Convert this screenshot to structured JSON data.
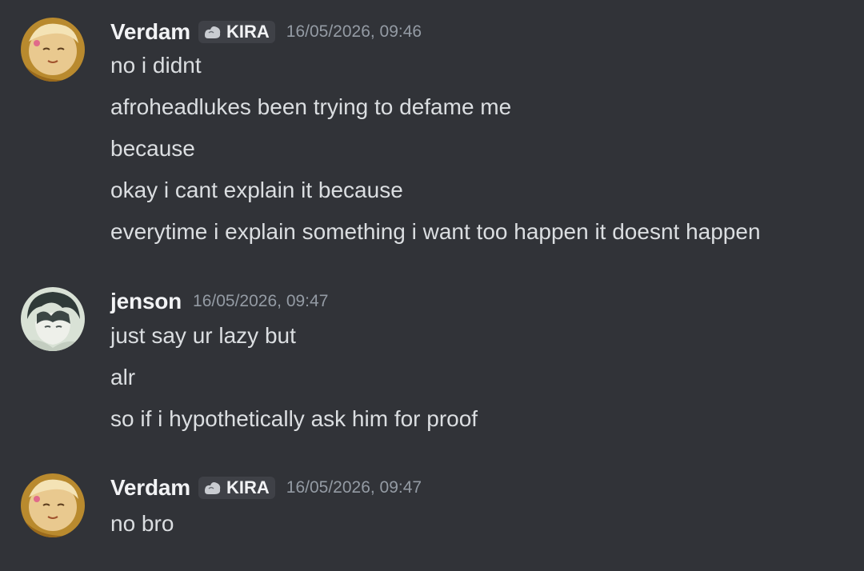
{
  "messages": [
    {
      "author": "Verdam",
      "tag": "KIRA",
      "timestamp": "16/05/2026, 09:46",
      "lines": [
        "no i didnt",
        "afroheadlukes been trying to defame me",
        "because",
        "okay i cant explain it because",
        "everytime i explain something i want too happen it doesnt happen"
      ]
    },
    {
      "author": "jenson",
      "timestamp": "16/05/2026, 09:47",
      "lines": [
        "just say ur lazy but",
        "alr",
        "so if i hypothetically ask him for proof"
      ]
    },
    {
      "author": "Verdam",
      "tag": "KIRA",
      "timestamp": "16/05/2026, 09:47",
      "lines": [
        "no bro"
      ]
    }
  ],
  "colors": {
    "background": "#313338",
    "username": "#f2f3f5",
    "message_text": "#dbdee1",
    "timestamp": "#949ba4",
    "tag_background": "#3f4147"
  }
}
